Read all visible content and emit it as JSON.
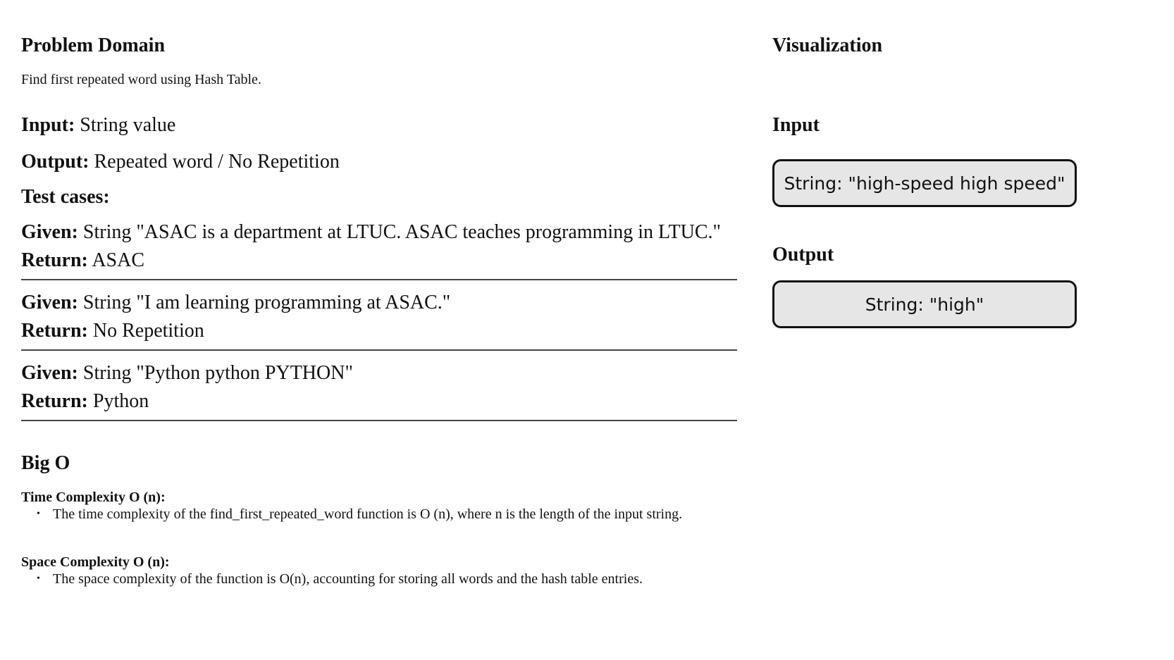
{
  "problem": {
    "title": "Problem Domain",
    "description": "Find first repeated word using Hash Table.",
    "input_label": "Input:",
    "input_value": " String value",
    "output_label": "Output:",
    "output_value": " Repeated word / No Repetition",
    "test_cases_title": "Test cases:",
    "given_label": "Given:",
    "return_label": "Return:",
    "cases": [
      {
        "given": " String \"ASAC is a department at LTUC. ASAC teaches programming in LTUC.\"",
        "return": " ASAC"
      },
      {
        "given": " String \"I am learning programming at ASAC.\"",
        "return": " No Repetition"
      },
      {
        "given": " String \"Python python PYTHON\"",
        "return": " Python"
      }
    ]
  },
  "big_o": {
    "title": "Big O",
    "time_title": "Time Complexity O (n):",
    "time_bullets": [
      "The time complexity of the find_first_repeated_word function is O (n), where n is the length of the input string."
    ],
    "space_title": "Space Complexity O (n):",
    "space_bullets": [
      "The space complexity of the function is O(n), accounting for storing all words and the hash table entries."
    ]
  },
  "visualization": {
    "title": "Visualization",
    "input_title": "Input",
    "input_box": "String: \"high-speed high speed\"",
    "output_title": "Output",
    "output_box": "String: \"high\""
  }
}
